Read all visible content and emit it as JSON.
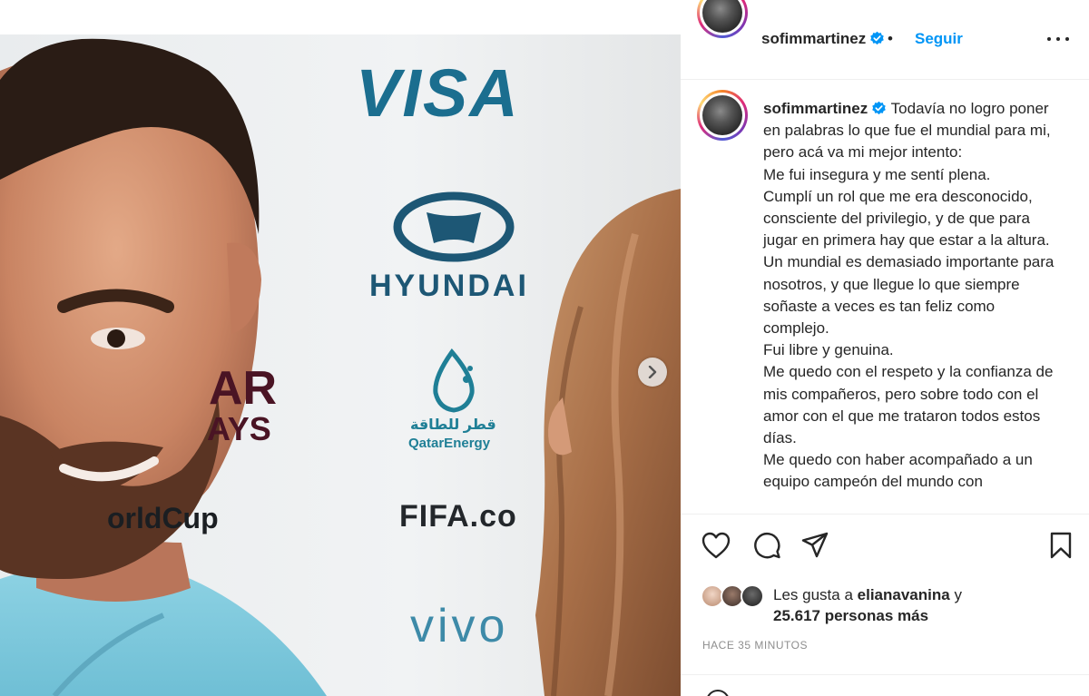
{
  "post": {
    "username": "sofimmartinez",
    "separator": "•",
    "follow_label": "Seguir",
    "caption": [
      "Todavía no logro poner en palabras lo que fue el mundial para mi, pero acá va mi mejor intento:",
      "Me fui insegura y me sentí plena.",
      "Cumplí un rol que me era desconocido, consciente del privilegio, y de que para jugar en primera hay que estar a la altura. Un mundial es demasiado importante para nosotros, y que llegue lo que siempre soñaste a veces es tan feliz como complejo.",
      "Fui libre y genuina.",
      "Me quedo con el respeto y la confianza de mis compañeros, pero sobre todo con el amor con el que me trataron todos estos días.",
      "Me quedo con haber acompañado a un equipo campeón del mundo con"
    ],
    "likes_prefix": "Les gusta a",
    "likes_user": "elianavanina",
    "likes_and": "y",
    "likes_count_text": "25.617 personas más",
    "time_ago": "HACE 35 MINUTOS"
  },
  "photo": {
    "sponsors": {
      "visa": "VISA",
      "hyundai": "HYUNDAI",
      "qatar_energy": "QatarEnergy",
      "qatar_arabic": "قطر للطاقة",
      "fifa": "FIFA.co",
      "vivo": "vivo",
      "ar": "AR",
      "ays": "AYS",
      "worldcup": "orldCup"
    }
  },
  "icons": {
    "verified": "verified-badge-icon",
    "more": "more-options-icon",
    "like": "heart-icon",
    "comment": "comment-icon",
    "share": "send-icon",
    "save": "bookmark-icon",
    "next": "chevron-right-icon"
  },
  "colors": {
    "accent": "#0095f6",
    "text": "#262626",
    "muted": "#8e8e8e",
    "shirt": "#7ec9dc"
  }
}
